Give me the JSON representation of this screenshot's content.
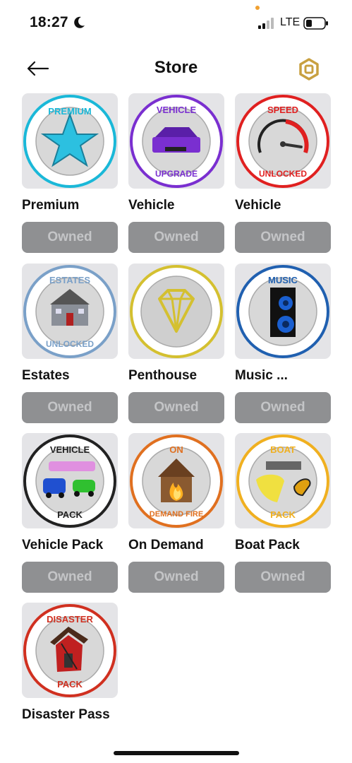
{
  "status_bar": {
    "time": "18:27",
    "carrier": "LTE"
  },
  "header": {
    "title": "Store"
  },
  "items": [
    {
      "name": "Premium",
      "button": "Owned",
      "badge_top": "PREMIUM",
      "badge_bottom": "",
      "icon": "star-icon"
    },
    {
      "name": "Vehicle",
      "button": "Owned",
      "badge_top": "VEHICLE",
      "badge_bottom": "UPGRADE",
      "icon": "car-icon"
    },
    {
      "name": "Vehicle",
      "button": "Owned",
      "badge_top": "SPEED",
      "badge_bottom": "UNLOCKED",
      "icon": "speedometer-icon"
    },
    {
      "name": "Estates",
      "button": "Owned",
      "badge_top": "ESTATES",
      "badge_bottom": "UNLOCKED",
      "icon": "house-icon"
    },
    {
      "name": "Penthouse",
      "button": "Owned",
      "badge_top": "",
      "badge_bottom": "",
      "icon": "diamond-icon"
    },
    {
      "name": "Music ...",
      "button": "Owned",
      "badge_top": "MUSIC",
      "badge_bottom": "",
      "icon": "speaker-icon"
    },
    {
      "name": "Vehicle Pack",
      "button": "Owned",
      "badge_top": "VEHICLE",
      "badge_bottom": "PACK",
      "icon": "cars-icon"
    },
    {
      "name": "On Demand",
      "button": "Owned",
      "badge_top": "ON",
      "badge_bottom": "DEMAND FIRE",
      "icon": "fire-house-icon"
    },
    {
      "name": "Boat Pack",
      "button": "Owned",
      "badge_top": "BOAT",
      "badge_bottom": "PACK",
      "icon": "boats-icon"
    },
    {
      "name": "Disaster Pass",
      "button": "",
      "badge_top": "DISASTER",
      "badge_bottom": "PACK",
      "icon": "broken-house-icon"
    }
  ],
  "colors": {
    "premium": "#1ab8d8",
    "vehicle": "#7a2fd0",
    "speed": "#e02020",
    "estates": "#7aa0c8",
    "penthouse": "#d4c030",
    "music": "#2060b0",
    "vehicle_pack": "#222222",
    "on_demand": "#e07020",
    "boat": "#f0b020",
    "disaster": "#d03020"
  }
}
